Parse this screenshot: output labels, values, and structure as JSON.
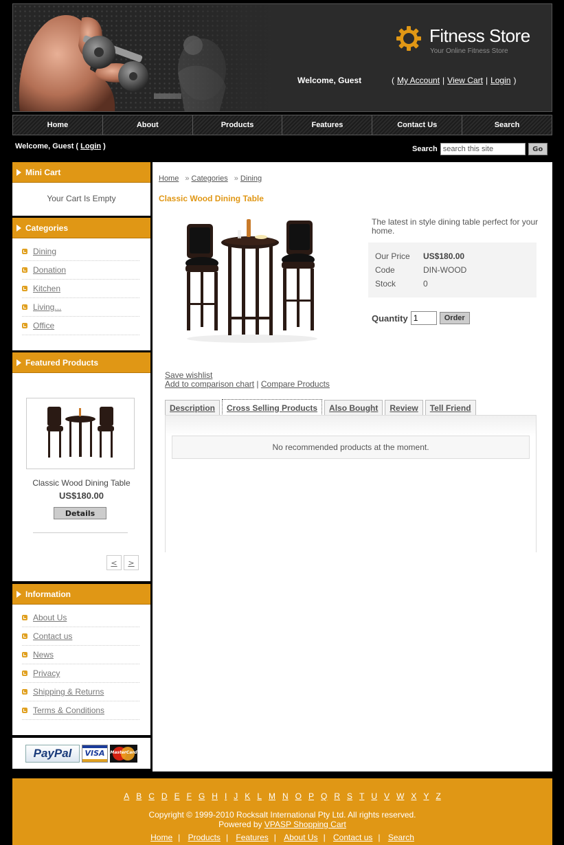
{
  "header": {
    "logo_title": "Fitness Store",
    "logo_tagline": "Your Online Fitness Store",
    "welcome": "Welcome, Guest",
    "account_links": [
      "My Account",
      "View Cart",
      "Login"
    ]
  },
  "nav": [
    "Home",
    "About",
    "Products",
    "Features",
    "Contact Us",
    "Search"
  ],
  "subbar": {
    "welcome_prefix": "Welcome, Guest (",
    "login": "Login",
    "welcome_suffix": ")",
    "search_label": "Search",
    "search_placeholder": "search this site",
    "go": "Go"
  },
  "sidebar": {
    "mini_cart": {
      "title": "Mini Cart",
      "text": "Your Cart Is Empty"
    },
    "categories": {
      "title": "Categories",
      "items": [
        "Dining",
        "Donation",
        "Kitchen",
        "Living...",
        "Office"
      ]
    },
    "featured": {
      "title": "Featured Products",
      "name": "Classic Wood Dining Table",
      "price": "US$180.00",
      "details": "Details",
      "prev": "<",
      "next": ">"
    },
    "information": {
      "title": "Information",
      "items": [
        "About Us",
        "Contact us",
        "News",
        "Privacy",
        "Shipping & Returns",
        "Terms & Conditions"
      ]
    },
    "payments": [
      "PayPal",
      "VISA",
      "MasterCard"
    ]
  },
  "main": {
    "breadcrumb": [
      "Home",
      "Categories",
      "Dining"
    ],
    "breadcrumb_sep": "»",
    "title": "Classic Wood Dining Table",
    "description": "The latest in style dining table perfect for your home.",
    "price_label": "Our Price",
    "price": "US$180.00",
    "code_label": "Code",
    "code": "DIN-WOOD",
    "stock_label": "Stock",
    "stock": "0",
    "quantity_label": "Quantity",
    "quantity": "1",
    "order": "Order",
    "save_wishlist": "Save wishlist",
    "add_compare": "Add to comparison chart",
    "compare_sep": "|",
    "compare_products": "Compare Products",
    "tabs": [
      "Description",
      "Cross Selling Products",
      "Also Bought",
      "Review",
      "Tell Friend"
    ],
    "tab_message": "No recommended products at the moment."
  },
  "footer": {
    "alphabet": [
      "A",
      "B",
      "C",
      "D",
      "E",
      "F",
      "G",
      "H",
      "I",
      "J",
      "K",
      "L",
      "M",
      "N",
      "O",
      "P",
      "Q",
      "R",
      "S",
      "T",
      "U",
      "V",
      "W",
      "X",
      "Y",
      "Z"
    ],
    "copyright": "Copyright © 1999-2010 Rocksalt International Pty Ltd. All rights reserved.",
    "powered_prefix": "Powered by",
    "powered_link": "VPASP Shopping Cart",
    "links": [
      "Home",
      "Products",
      "Features",
      "About Us",
      "Contact us",
      "Search"
    ]
  },
  "colors": {
    "accent": "#e09715",
    "background": "#000000"
  }
}
